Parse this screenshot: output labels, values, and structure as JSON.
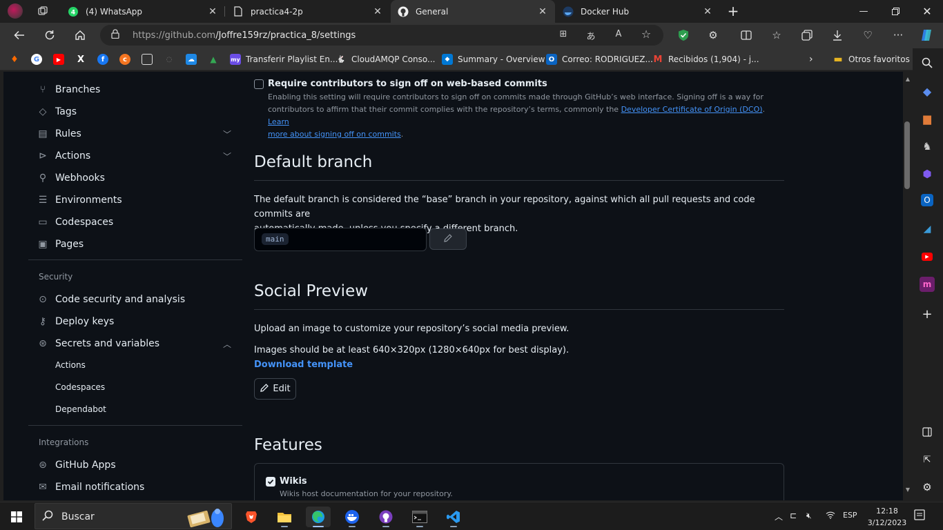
{
  "browser": {
    "tabs": [
      {
        "title": "(4) WhatsApp",
        "icon": "whatsapp-icon",
        "badge": "4"
      },
      {
        "title": "practica4-2p",
        "icon": "document-icon"
      },
      {
        "title": "General",
        "icon": "github-icon",
        "active": true
      },
      {
        "title": "Docker Hub",
        "icon": "docker-icon"
      }
    ],
    "url_host": "https://github.com",
    "url_path": "/Joffre159rz/practica_8/settings",
    "favorites": [
      {
        "label": "Transferir Playlist En...",
        "color": "#6b4de6",
        "glyph": "my"
      },
      {
        "label": "CloudAMQP Conso...",
        "color": "#444444",
        "glyph": "🐇"
      },
      {
        "label": "Summary - Overview",
        "color": "#0078d4",
        "glyph": "◆"
      },
      {
        "label": "Correo: RODRIGUEZ...",
        "color": "#0a64c2",
        "glyph": "O"
      },
      {
        "label": "Recibidos (1,904) - j...",
        "color": "#ea4335",
        "glyph": "M"
      },
      {
        "label": "Otros favoritos",
        "color": "#e6b422",
        "glyph": "▬"
      }
    ]
  },
  "sidebar": {
    "items_top": [
      {
        "label": "Branches",
        "icon": "branch-icon"
      },
      {
        "label": "Tags",
        "icon": "tag-icon"
      },
      {
        "label": "Rules",
        "icon": "rules-icon",
        "chevron": "down"
      },
      {
        "label": "Actions",
        "icon": "play-icon",
        "chevron": "down"
      },
      {
        "label": "Webhooks",
        "icon": "webhook-icon"
      },
      {
        "label": "Environments",
        "icon": "server-icon"
      },
      {
        "label": "Codespaces",
        "icon": "codespaces-icon"
      },
      {
        "label": "Pages",
        "icon": "browser-icon"
      }
    ],
    "security_heading": "Security",
    "security_items": [
      {
        "label": "Code security and analysis",
        "icon": "codescan-icon"
      },
      {
        "label": "Deploy keys",
        "icon": "key-icon"
      },
      {
        "label": "Secrets and variables",
        "icon": "asterisk-icon",
        "chevron": "up"
      }
    ],
    "secrets_sub": [
      "Actions",
      "Codespaces",
      "Dependabot"
    ],
    "integrations_heading": "Integrations",
    "integration_items": [
      {
        "label": "GitHub Apps",
        "icon": "apps-icon"
      },
      {
        "label": "Email notifications",
        "icon": "mail-icon"
      }
    ]
  },
  "content": {
    "signoff": {
      "label": "Require contributors to sign off on web-based commits",
      "desc1": "Enabling this setting will require contributors to sign off on commits made through GitHub’s web interface. Signing off is a way for",
      "desc2": "contributors to affirm that their commit complies with the repository’s terms, commonly the",
      "link1": "Developer Certificate of Origin (DCO)",
      "link2a": "Learn",
      "link2b": "more about signing off on commits",
      "checked": false
    },
    "default_branch": {
      "heading": "Default branch",
      "line1": "The default branch is considered the “base” branch in your repository, against which all pull requests and code commits are",
      "line2": "automatically made, unless you specify a different branch.",
      "branch": "main"
    },
    "social": {
      "heading": "Social Preview",
      "line1": "Upload an image to customize your repository’s social media preview.",
      "line2": "Images should be at least 640×320px (1280×640px for best display).",
      "download": "Download template",
      "edit": "Edit"
    },
    "features": {
      "heading": "Features",
      "wikis_label": "Wikis",
      "wikis_desc": "Wikis host documentation for your repository.",
      "wikis_checked": true
    }
  },
  "taskbar": {
    "search_placeholder": "Buscar",
    "lang": "ESP",
    "time": "12:18",
    "date": "3/12/2023"
  }
}
